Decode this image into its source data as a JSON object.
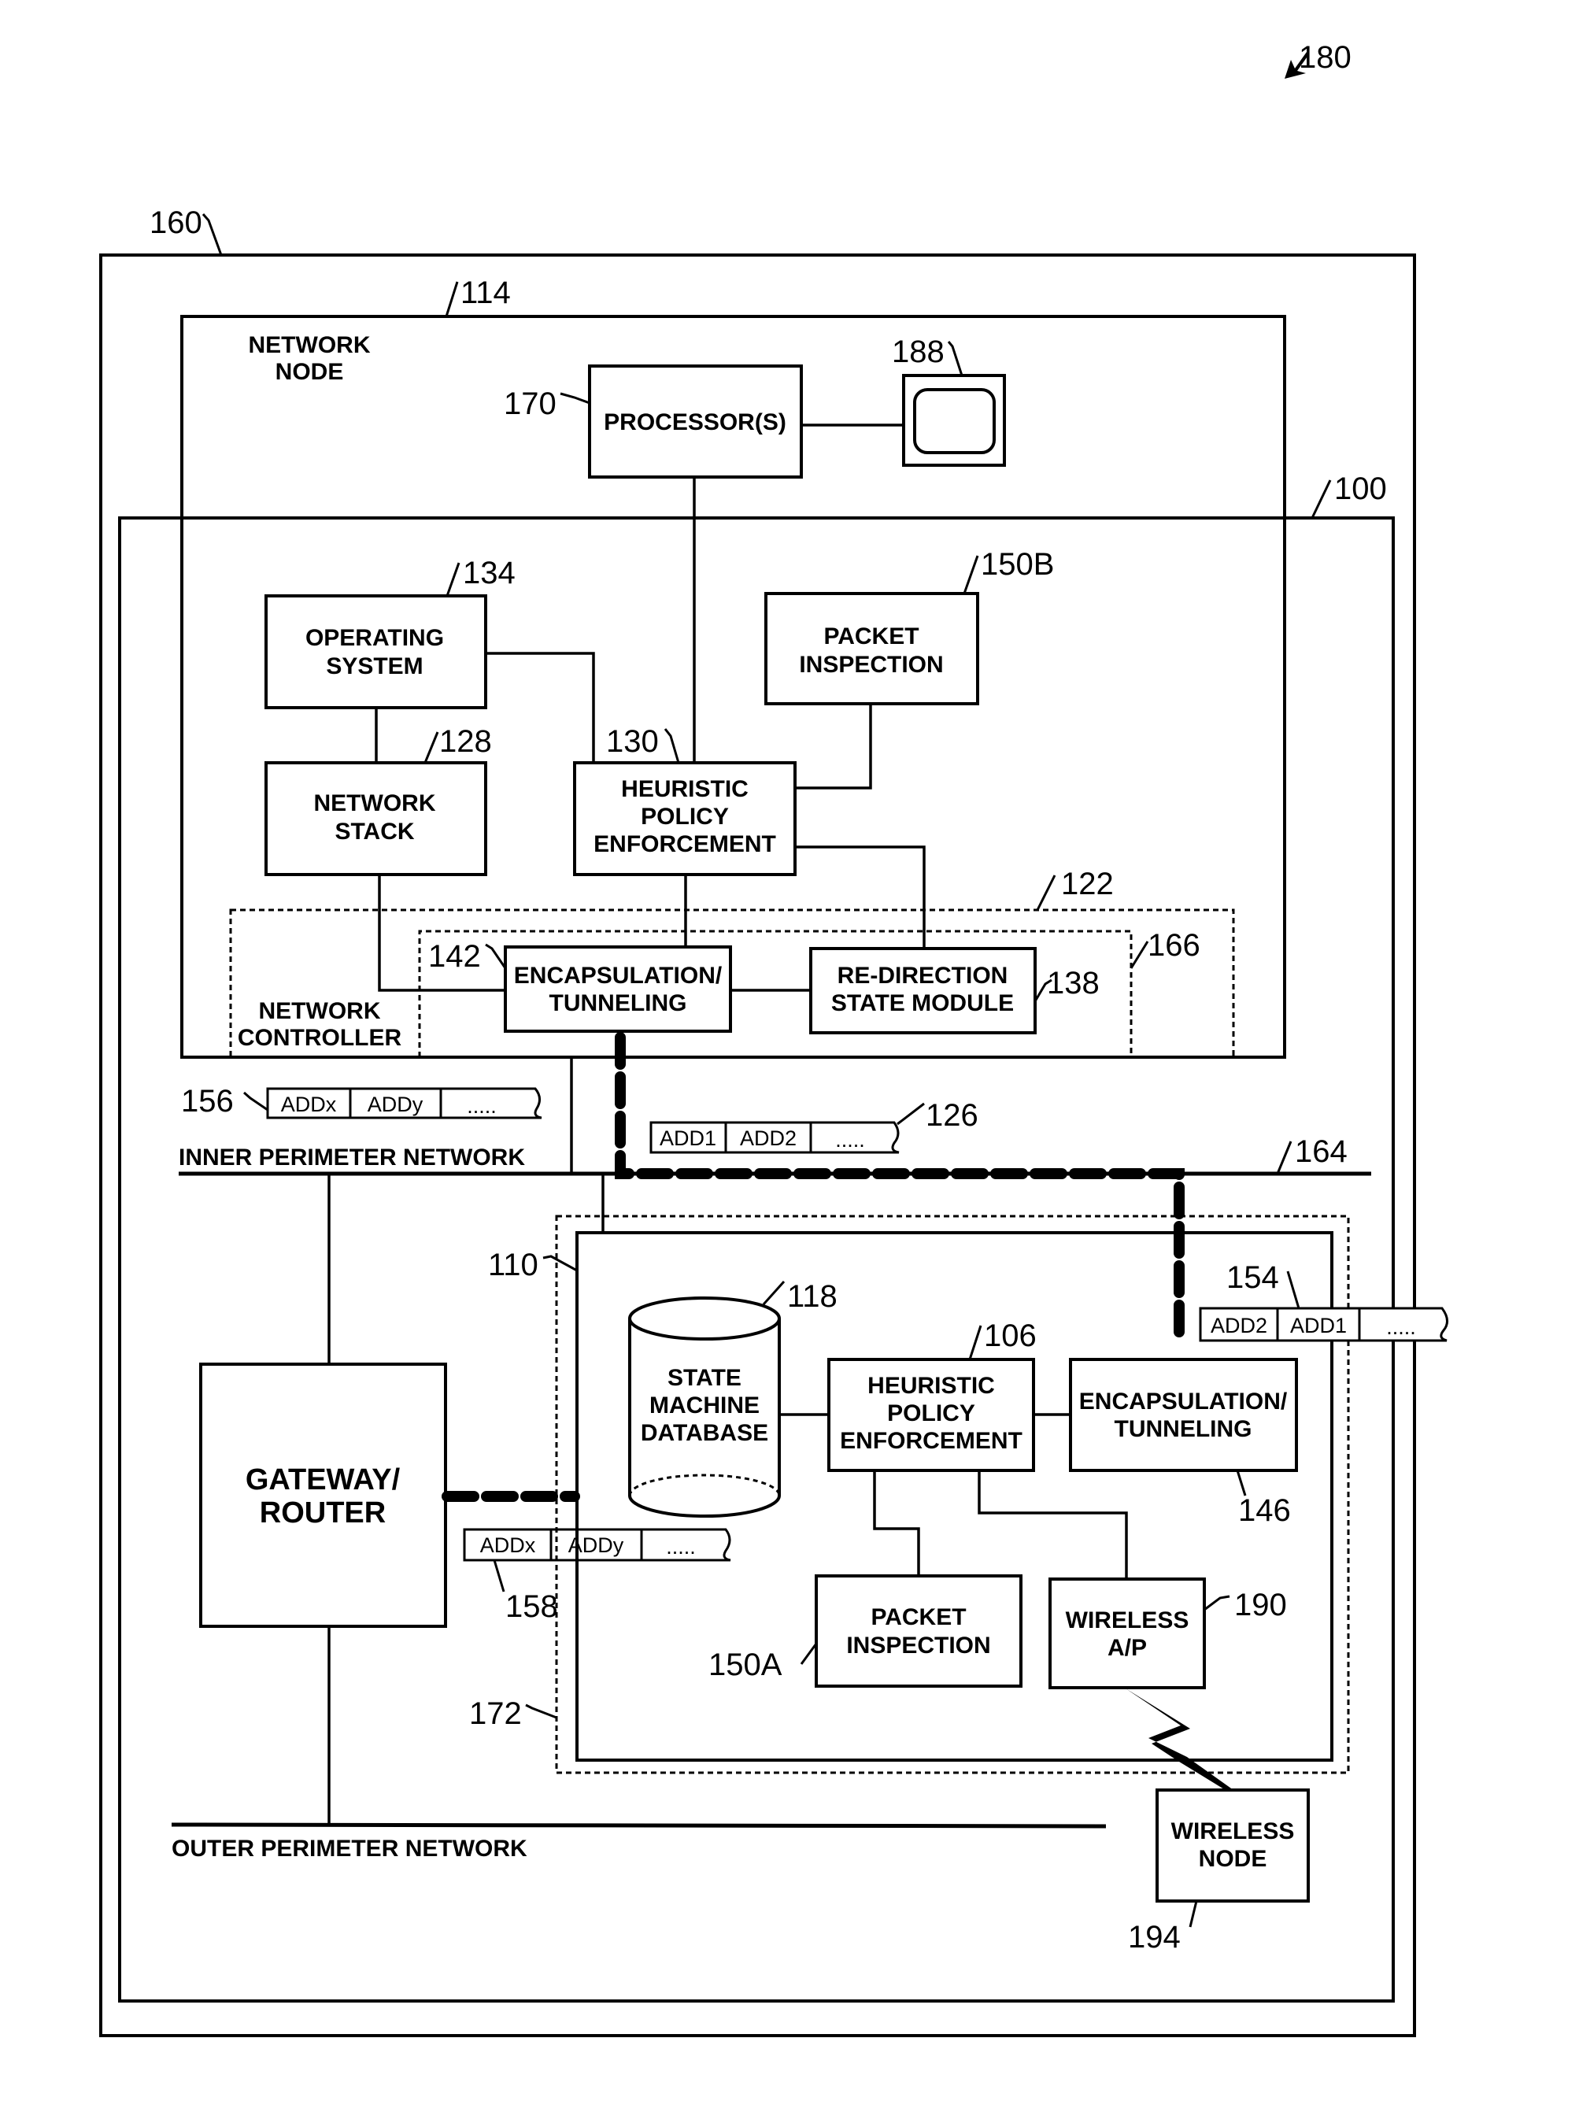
{
  "figure": {
    "ref": "180",
    "colors": {
      "ink": "#000000",
      "paper": "#ffffff"
    }
  },
  "enclosures": {
    "outer": {
      "ref": "160"
    },
    "network_node": {
      "ref": "114",
      "label_line1": "NETWORK",
      "label_line2": "NODE"
    },
    "system": {
      "ref": "100"
    },
    "network_controller": {
      "ref": "122",
      "label_line1": "NETWORK",
      "label_line2": "CONTROLLER"
    },
    "controller_inner": {
      "ref": "166"
    },
    "device": {
      "ref": "110"
    },
    "device_outer": {
      "ref": "172"
    }
  },
  "components": {
    "processor": {
      "ref": "170",
      "line1": "PROCESSOR(S)"
    },
    "display": {
      "ref": "188",
      "icon": "monitor-icon"
    },
    "operating_system": {
      "ref": "134",
      "line1": "OPERATING",
      "line2": "SYSTEM"
    },
    "packet_inspection_b": {
      "ref": "150B",
      "line1": "PACKET",
      "line2": "INSPECTION"
    },
    "network_stack": {
      "ref": "128",
      "line1": "NETWORK",
      "line2": "STACK"
    },
    "hpe_top": {
      "ref": "130",
      "line1": "HEURISTIC",
      "line2": "POLICY",
      "line3": "ENFORCEMENT"
    },
    "encap_top": {
      "ref": "142",
      "line1": "ENCAPSULATION/",
      "line2": "TUNNELING"
    },
    "redirection": {
      "ref": "138",
      "line1": "RE-DIRECTION",
      "line2": "STATE MODULE"
    },
    "state_db": {
      "ref": "118",
      "line1": "STATE",
      "line2": "MACHINE",
      "line3": "DATABASE",
      "icon": "database-cylinder-icon"
    },
    "hpe_bottom": {
      "ref": "106",
      "line1": "HEURISTIC",
      "line2": "POLICY",
      "line3": "ENFORCEMENT"
    },
    "encap_bottom": {
      "ref": "146",
      "line1": "ENCAPSULATION/",
      "line2": "TUNNELING"
    },
    "gateway": {
      "line1": "GATEWAY/",
      "line2": "ROUTER"
    },
    "packet_inspection_a": {
      "ref": "150A",
      "line1": "PACKET",
      "line2": "INSPECTION"
    },
    "wireless_ap": {
      "ref": "190",
      "line1": "WIRELESS",
      "line2": "A/P"
    },
    "wireless_node": {
      "ref": "194",
      "line1": "WIRELESS",
      "line2": "NODE",
      "link_icon": "lightning-bolt-icon"
    }
  },
  "networks": {
    "inner": {
      "ref": "164",
      "label": "INNER PERIMETER NETWORK"
    },
    "outer": {
      "label": "OUTER PERIMETER NETWORK"
    }
  },
  "packets": {
    "p156": {
      "ref": "156",
      "cells": [
        "ADDx",
        "ADDy",
        "....."
      ]
    },
    "p126": {
      "ref": "126",
      "cells": [
        "ADD1",
        "ADD2",
        "....."
      ]
    },
    "p154": {
      "ref": "154",
      "cells": [
        "ADD2",
        "ADD1",
        "....."
      ]
    },
    "p158": {
      "ref": "158",
      "cells": [
        "ADDx",
        "ADDy",
        "....."
      ]
    }
  }
}
